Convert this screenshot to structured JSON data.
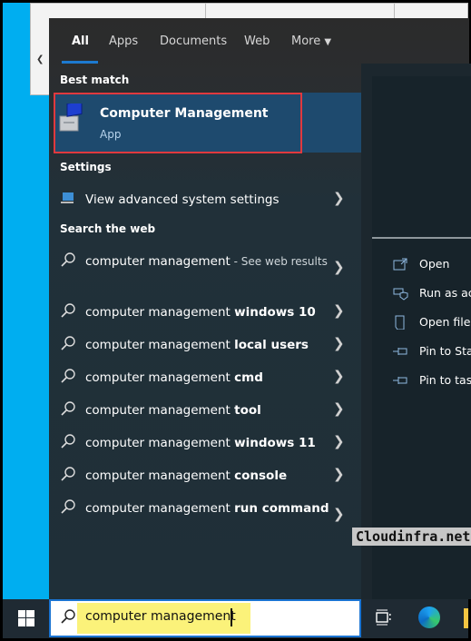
{
  "tabs": [
    {
      "label": "All",
      "active": true
    },
    {
      "label": "Apps"
    },
    {
      "label": "Documents"
    },
    {
      "label": "Web"
    },
    {
      "label": "More"
    }
  ],
  "sections": {
    "best_match": "Best match",
    "settings": "Settings",
    "search_web": "Search the web"
  },
  "best": {
    "title": "Computer Management",
    "subtitle": "App",
    "icon": "computer-management-icon"
  },
  "settings_item": {
    "label": "View advanced system settings",
    "icon": "system-settings-icon"
  },
  "web": [
    {
      "pre": "computer management",
      "bold": "",
      "muted": " - See web results"
    },
    {
      "pre": "computer management ",
      "bold": "windows 10"
    },
    {
      "pre": "computer management ",
      "bold": "local users"
    },
    {
      "pre": "computer management ",
      "bold": "cmd"
    },
    {
      "pre": "computer management ",
      "bold": "tool"
    },
    {
      "pre": "computer management ",
      "bold": "windows 11"
    },
    {
      "pre": "computer management ",
      "bold": "console"
    },
    {
      "pre": "computer management ",
      "bold": "run command"
    }
  ],
  "actions": [
    {
      "label": "Open",
      "icon": "open-icon"
    },
    {
      "label": "Run as ac",
      "icon": "shield-icon"
    },
    {
      "label": "Open file",
      "icon": "file-location-icon"
    },
    {
      "label": "Pin to Sta",
      "icon": "pin-icon"
    },
    {
      "label": "Pin to tas",
      "icon": "pin-icon"
    }
  ],
  "watermark": "Cloudinfra.net",
  "search": {
    "query": "computer management"
  },
  "colors": {
    "accent": "#1a74d2",
    "highlight_border": "#e0393e",
    "selection": "#1e4a6e",
    "query_highlight": "#fbf27a"
  }
}
